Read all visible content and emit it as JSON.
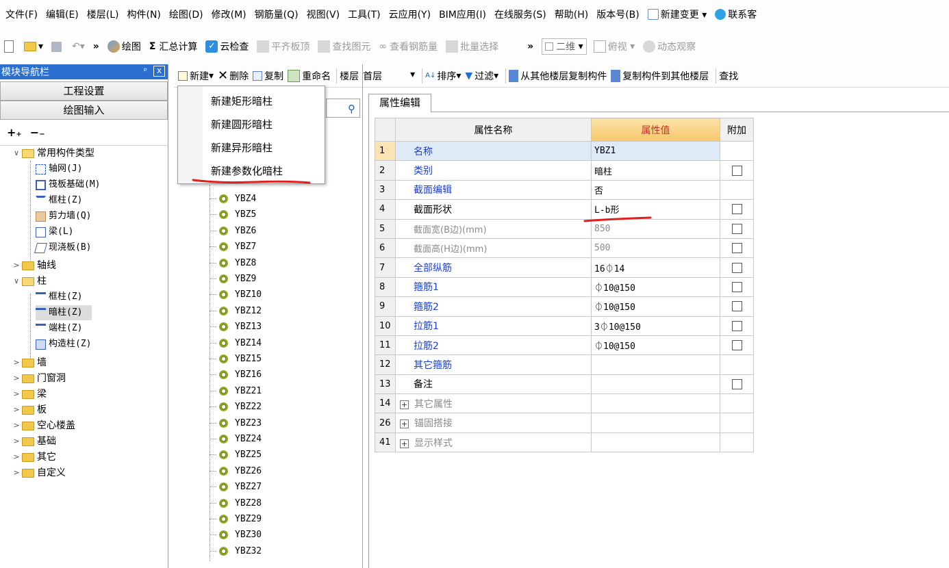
{
  "menubar": {
    "items": [
      "文件(F)",
      "编辑(E)",
      "楼层(L)",
      "构件(N)",
      "绘图(D)",
      "修改(M)",
      "钢筋量(Q)",
      "视图(V)",
      "工具(T)",
      "云应用(Y)",
      "BIM应用(I)",
      "在线服务(S)",
      "帮助(H)",
      "版本号(B)"
    ],
    "new_change": "新建变更",
    "contact": "联系客"
  },
  "toolbar": {
    "more": "»",
    "draw": "绘图",
    "sum_icon": "Σ",
    "sum": "汇总计算",
    "cloud_check": "云检查",
    "flat_slab": "平齐板顶",
    "find_elem": "查找图元",
    "view_rebar": "查看钢筋量",
    "batch_select": "批量选择",
    "more2": "»",
    "view_mode": "二维",
    "top_view": "俯视",
    "dynamic_view": "动态观察"
  },
  "nav": {
    "title": "模块导航栏",
    "pin": "ᵖ",
    "close": "x",
    "project_settings": "工程设置",
    "drawing_input": "绘图输入",
    "tree": {
      "common_types": "常用构件类型",
      "axis_grid": "轴网(J)",
      "raft": "筏板基础(M)",
      "frame_col": "框柱(Z)",
      "shear_wall": "剪力墙(Q)",
      "beam": "梁(L)",
      "cast_slab": "现浇板(B)",
      "axis_line": "轴线",
      "column": "柱",
      "col_frame": "框柱(Z)",
      "col_hidden": "暗柱(Z)",
      "col_end": "端柱(Z)",
      "col_struct": "构造柱(Z)",
      "wall": "墙",
      "door_window": "门窗洞",
      "beam2": "梁",
      "slab": "板",
      "hollow_floor": "空心楼盖",
      "foundation": "基础",
      "other": "其它",
      "custom": "自定义"
    }
  },
  "comp_toolbar": {
    "new": "新建",
    "delete": "删除",
    "copy": "复制",
    "rename": "重命名",
    "floor_label": "楼层",
    "floor_value": "首层",
    "sort": "排序",
    "filter": "过滤",
    "copy_from_other": "从其他楼层复制构件",
    "copy_to_other": "复制构件到其他楼层",
    "find": "查找"
  },
  "dropdown": {
    "items": [
      "新建矩形暗柱",
      "新建圆形暗柱",
      "新建异形暗柱",
      "新建参数化暗柱"
    ]
  },
  "component_list": [
    "YBZ4",
    "YBZ5",
    "YBZ6",
    "YBZ7",
    "YBZ8",
    "YBZ9",
    "YBZ10",
    "YBZ12",
    "YBZ13",
    "YBZ14",
    "YBZ15",
    "YBZ16",
    "YBZ21",
    "YBZ22",
    "YBZ23",
    "YBZ24",
    "YBZ25",
    "YBZ26",
    "YBZ27",
    "YBZ28",
    "YBZ29",
    "YBZ30",
    "YBZ32"
  ],
  "properties": {
    "tab": "属性编辑",
    "headers": {
      "name": "属性名称",
      "value": "属性值",
      "extra": "附加"
    },
    "rows": [
      {
        "num": "1",
        "name": "名称",
        "value": "YBZ1"
      },
      {
        "num": "2",
        "name": "类别",
        "value": "暗柱"
      },
      {
        "num": "3",
        "name": "截面编辑",
        "value": "否"
      },
      {
        "num": "4",
        "name": "截面形状",
        "value": "L-b形"
      },
      {
        "num": "5",
        "name": "截面宽(B边)(mm)",
        "value": "850"
      },
      {
        "num": "6",
        "name": "截面高(H边)(mm)",
        "value": "500"
      },
      {
        "num": "7",
        "name": "全部纵筋",
        "value": "16⏀14"
      },
      {
        "num": "8",
        "name": "箍筋1",
        "value": "⏀10@150"
      },
      {
        "num": "9",
        "name": "箍筋2",
        "value": "⏀10@150"
      },
      {
        "num": "10",
        "name": "拉筋1",
        "value": "3⏀10@150"
      },
      {
        "num": "11",
        "name": "拉筋2",
        "value": "⏀10@150"
      },
      {
        "num": "12",
        "name": "其它箍筋",
        "value": ""
      },
      {
        "num": "13",
        "name": "备注",
        "value": ""
      },
      {
        "num": "14",
        "name": "其它属性",
        "value": ""
      },
      {
        "num": "26",
        "name": "锚固搭接",
        "value": ""
      },
      {
        "num": "41",
        "name": "显示样式",
        "value": ""
      }
    ]
  },
  "colors": {
    "nav_title": "#2b6fd0",
    "blue_link": "#1a3fd6",
    "underline_red": "#e0201f",
    "value_header": "#f6c66b"
  }
}
